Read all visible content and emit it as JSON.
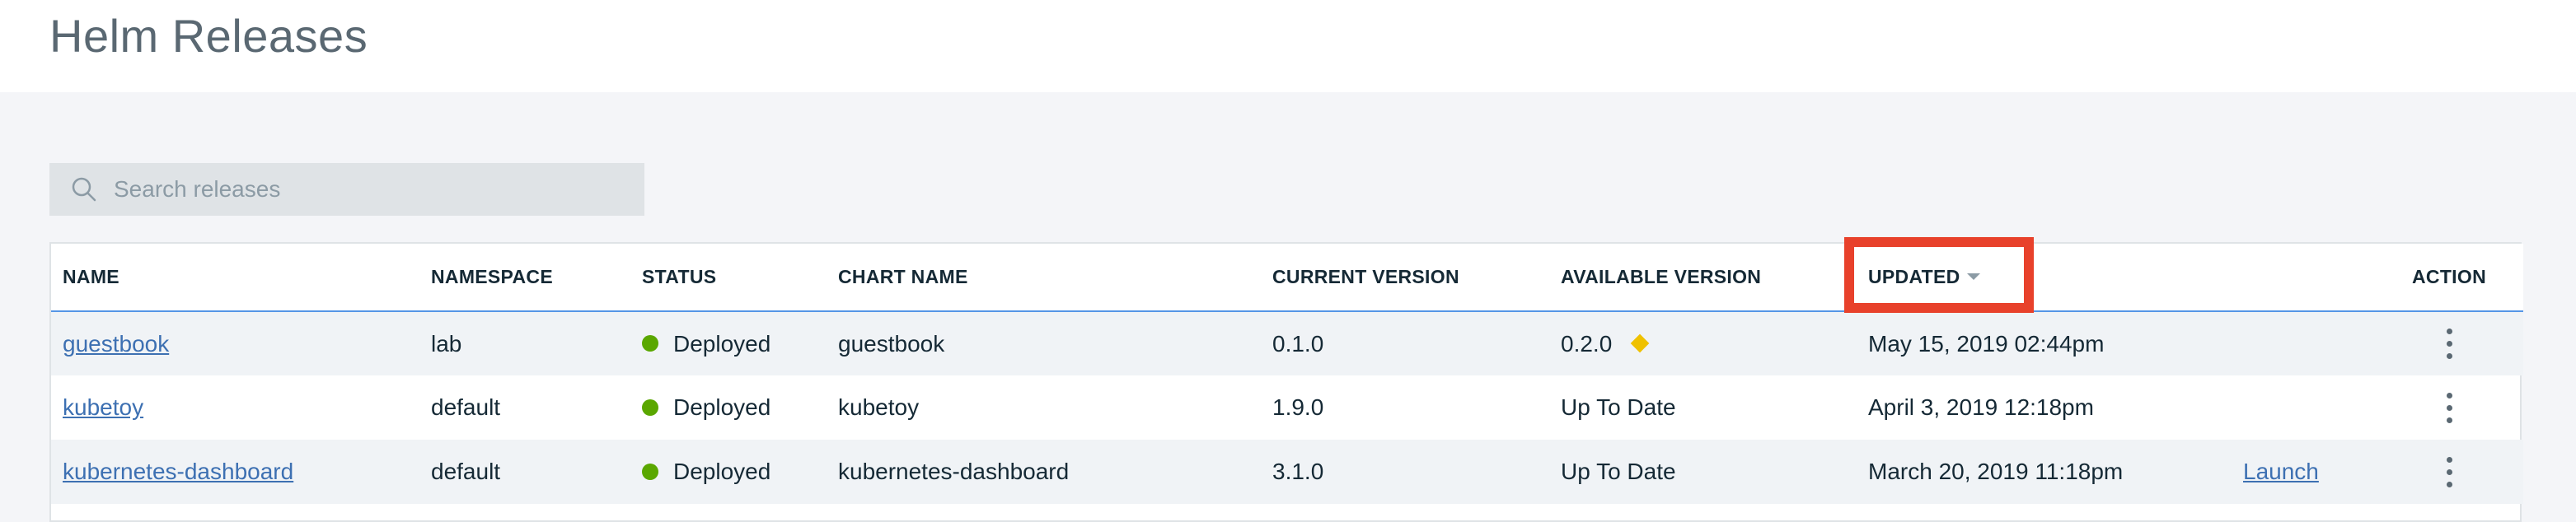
{
  "page": {
    "title": "Helm Releases"
  },
  "search": {
    "placeholder": "Search releases"
  },
  "table": {
    "headers": {
      "name": "NAME",
      "namespace": "NAMESPACE",
      "status": "STATUS",
      "chart_name": "CHART NAME",
      "current_version": "CURRENT VERSION",
      "available_version": "AVAILABLE VERSION",
      "updated": "UPDATED",
      "action": "ACTION"
    },
    "rows": [
      {
        "name": "guestbook",
        "namespace": "lab",
        "status": "Deployed",
        "chart_name": "guestbook",
        "current_version": "0.1.0",
        "available_version": "0.2.0",
        "updated": "May 15, 2019 02:44pm",
        "launch": ""
      },
      {
        "name": "kubetoy",
        "namespace": "default",
        "status": "Deployed",
        "chart_name": "kubetoy",
        "current_version": "1.9.0",
        "available_version": "Up To Date",
        "updated": "April 3, 2019 12:18pm",
        "launch": ""
      },
      {
        "name": "kubernetes-dashboard",
        "namespace": "default",
        "status": "Deployed",
        "chart_name": "kubernetes-dashboard",
        "current_version": "3.1.0",
        "available_version": "Up To Date",
        "updated": "March 20, 2019 11:18pm",
        "launch": "Launch"
      }
    ]
  },
  "colors": {
    "status_deployed": "#5aa700",
    "update_available": "#efc100",
    "highlight": "#e8412b",
    "link": "#3d70b2"
  },
  "icons": {
    "search": "search-icon",
    "status": "status-dot-icon",
    "update": "update-available-icon",
    "sort": "sort-descending-icon",
    "overflow": "overflow-menu-icon"
  }
}
